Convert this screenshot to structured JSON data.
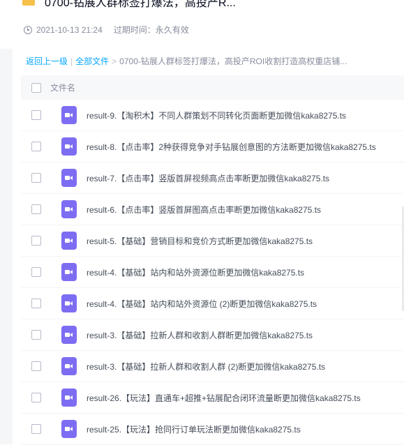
{
  "title": "0700-钻展人群标签打爆法，高投产R...",
  "meta": {
    "created": "2021-10-13 21:24",
    "expire": "过期时间：永久有效"
  },
  "breadcrumb": {
    "back": "返回上一级",
    "sep": "|",
    "all": "全部文件",
    "arrow": ">",
    "current": "0700-钻展人群标签打爆法，高投产ROI收割打造高权重店铺..."
  },
  "header": {
    "column": "文件名"
  },
  "files": [
    "result-9.【淘积木】不同人群策划不同转化页面断更加微信kaka8275.ts",
    "result-8.【点击率】2种获得竞争对手钻展创意图的方法断更加微信kaka8275.ts",
    "result-7.【点击率】竖版首屏视频高点击率断更加微信kaka8275.ts",
    "result-6.【点击率】竖版首屏图高点击率断更加微信kaka8275.ts",
    "result-5.【基础】营销目标和竞价方式断更加微信kaka8275.ts",
    "result-4.【基础】站内和站外资源位断更加微信kaka8275.ts",
    "result-4.【基础】站内和站外资源位 (2)断更加微信kaka8275.ts",
    "result-3.【基础】拉新人群和收割人群断更加微信kaka8275.ts",
    "result-3.【基础】拉新人群和收割人群 (2)断更加微信kaka8275.ts",
    "result-26.【玩法】直通车+超推+钻展配合闭环流量断更加微信kaka8275.ts",
    "result-25.【玩法】抢同行订单玩法断更加微信kaka8275.ts"
  ],
  "icons": {
    "folder": "folder-icon",
    "clock": "clock-icon",
    "file": "video-file-icon"
  },
  "colors": {
    "link": "#06a7ff",
    "video_icon": "#7d6df2",
    "folder": "#f5c14a"
  }
}
